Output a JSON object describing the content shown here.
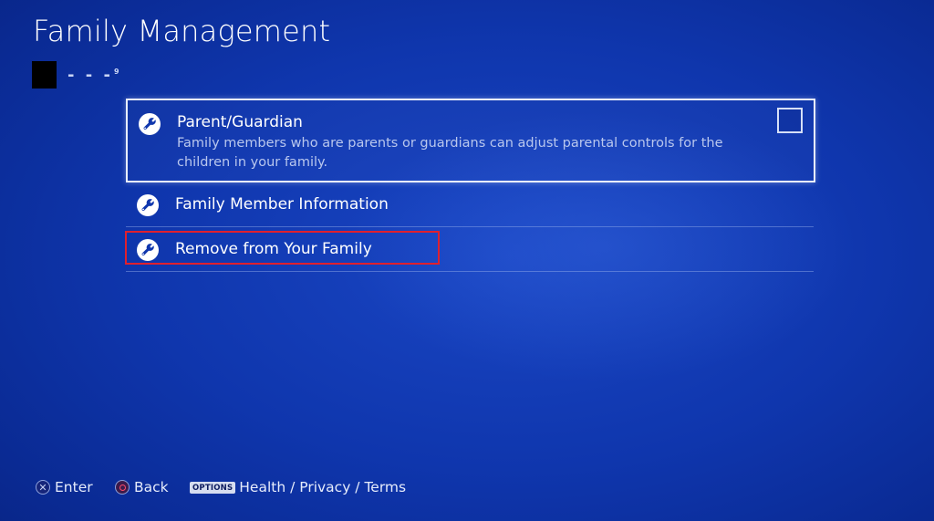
{
  "page": {
    "title": "Family Management"
  },
  "user": {
    "name": "- - -",
    "superscript": "9"
  },
  "menu": {
    "items": [
      {
        "id": "parent-guardian",
        "label": "Parent/Guardian",
        "description": "Family members who are parents or guardians can adjust parental controls for the children in your family.",
        "checked": false,
        "icon": "wrench-icon"
      },
      {
        "id": "family-member-information",
        "label": "Family Member Information",
        "icon": "wrench-icon"
      },
      {
        "id": "remove-from-family",
        "label": "Remove from Your Family",
        "icon": "wrench-icon",
        "highlighted": true
      }
    ]
  },
  "footer": {
    "enter_label": "Enter",
    "back_label": "Back",
    "options_badge": "OPTIONS",
    "options_label": "Health / Privacy / Terms"
  },
  "colors": {
    "background": "#0f36ad",
    "highlight": "#e0202e",
    "focus_border": "#e8eefc"
  }
}
